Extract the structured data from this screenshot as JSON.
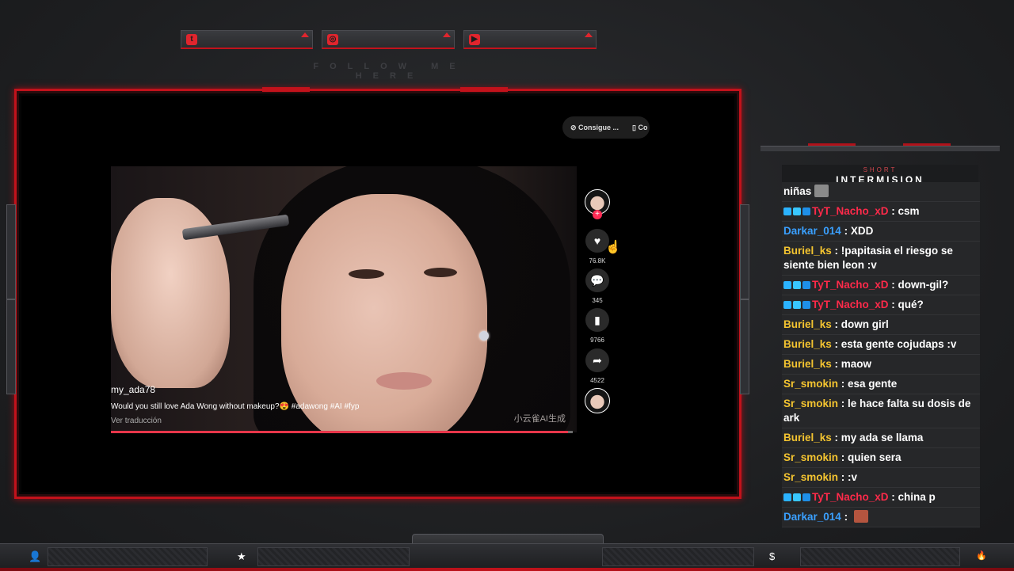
{
  "social": {
    "twitter_icon": "twitter-icon",
    "instagram_icon": "instagram-icon",
    "youtube_icon": "youtube-icon",
    "follow_text": "FOLLOW ME HERE"
  },
  "video": {
    "top_pills": [
      "Consigue ...",
      "Co"
    ],
    "username": "my_ada78",
    "caption": "Would you still love Ada Wong without makeup?😍 #adawong #AI #fyp",
    "translate": "Ver traducción",
    "watermark": "小云雀AI生成",
    "progress": 0.99,
    "likes": "76.8K",
    "comments": "345",
    "saves": "9766",
    "shares": "4522"
  },
  "chat": {
    "title_small": "SHORT",
    "title_big": "INTERMISION",
    "messages": [
      {
        "user": "",
        "text": "niñas",
        "color": "#ffffff",
        "badges": false,
        "emote": true
      },
      {
        "user": "TyT_Nacho_xD",
        "text": " : csm",
        "color": "#ff2a4a",
        "badges": true,
        "emote": false
      },
      {
        "user": "Darkar_014",
        "text": " : XDD",
        "color": "#3aa0ff",
        "badges": false,
        "emote": false
      },
      {
        "user": "Buriel_ks",
        "text": " : !papitasia el riesgo se siente bien leon :v",
        "color": "#f4c430",
        "badges": false,
        "emote": false
      },
      {
        "user": "TyT_Nacho_xD",
        "text": " : down-gil?",
        "color": "#ff2a4a",
        "badges": true,
        "emote": false
      },
      {
        "user": "TyT_Nacho_xD",
        "text": " : qué?",
        "color": "#ff2a4a",
        "badges": true,
        "emote": false
      },
      {
        "user": "Buriel_ks",
        "text": " : down girl",
        "color": "#f4c430",
        "badges": false,
        "emote": false
      },
      {
        "user": "Buriel_ks",
        "text": " : esta gente cojudaps :v",
        "color": "#f4c430",
        "badges": false,
        "emote": false
      },
      {
        "user": "Buriel_ks",
        "text": " : maow",
        "color": "#f4c430",
        "badges": false,
        "emote": false
      },
      {
        "user": "Sr_smokin",
        "text": " : esa gente",
        "color": "#f4c430",
        "badges": false,
        "emote": false
      },
      {
        "user": "Sr_smokin",
        "text": " : le hace falta su dosis de ark",
        "color": "#f4c430",
        "badges": false,
        "emote": false
      },
      {
        "user": "Buriel_ks",
        "text": " : my ada se llama",
        "color": "#f4c430",
        "badges": false,
        "emote": false
      },
      {
        "user": "Sr_smokin",
        "text": " : quien sera",
        "color": "#f4c430",
        "badges": false,
        "emote": false
      },
      {
        "user": "Sr_smokin",
        "text": " : :v",
        "color": "#f4c430",
        "badges": false,
        "emote": false
      },
      {
        "user": "TyT_Nacho_xD",
        "text": " : china p",
        "color": "#ff2a4a",
        "badges": true,
        "emote": false
      },
      {
        "user": "Darkar_014",
        "text": " : ",
        "color": "#3aa0ff",
        "badges": false,
        "emote": true
      }
    ]
  },
  "bottom": {
    "icons": [
      "user-icon",
      "star-icon",
      "dollar-icon",
      "flame-icon"
    ],
    "glyphs": [
      "👤",
      "★",
      "$",
      "🔥"
    ]
  },
  "colors": {
    "accent": "#c2121b",
    "chat_bg": "#262729"
  }
}
